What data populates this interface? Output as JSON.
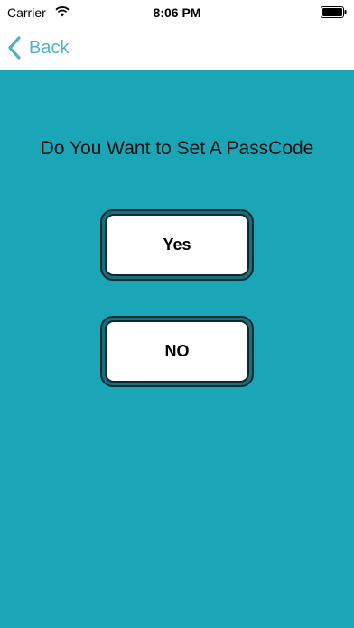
{
  "status_bar": {
    "carrier": "Carrier",
    "time": "8:06 PM",
    "wifi_icon": "wifi-icon",
    "battery_icon": "battery-icon"
  },
  "nav": {
    "back_label": "Back",
    "back_icon": "chevron-left-icon"
  },
  "main": {
    "prompt": "Do You Want to Set A PassCode",
    "yes_label": "Yes",
    "no_label": "NO"
  },
  "colors": {
    "accent": "#4fb3bf",
    "background": "#1ba6b8",
    "button_border": "#17707c"
  }
}
